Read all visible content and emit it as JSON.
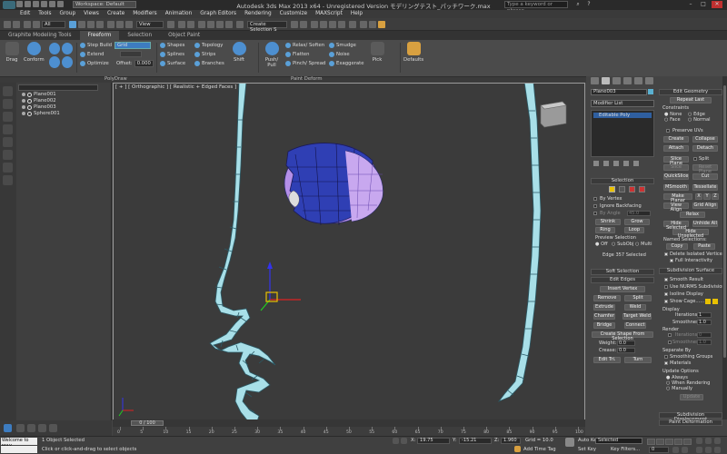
{
  "window": {
    "title": "Autodesk 3ds Max  2013 x64  -  Unregistered Version   モデリングテスト_パッチワーク.max",
    "workspace": "Workspace: Default",
    "search_placeholder": "Type a keyword or phrase"
  },
  "menubar": [
    "Edit",
    "Tools",
    "Group",
    "Views",
    "Create",
    "Modifiers",
    "Animation",
    "Graph Editors",
    "Rendering",
    "Customize",
    "MAXScript",
    "Help"
  ],
  "main_toolbar": {
    "selection_filter": "All",
    "reference_coord": "View",
    "named_selection": "Create Selection S"
  },
  "ribbon_tabs": [
    "Graphite Modeling Tools",
    "Freeform",
    "Selection",
    "Object Paint"
  ],
  "ribbon_active_tab": 1,
  "ribbon": {
    "drag": "Drag",
    "conform": "Conform",
    "step_build": "Step Build",
    "extend": "Extend",
    "optimize": "Optimize",
    "grid_value": "Grid",
    "offset_label": "Offset:",
    "offset_value": "0.000",
    "shapes": "Shapes",
    "splines": "Splines",
    "surface": "Surface",
    "topology": "Topology",
    "strips": "Strips",
    "branches": "Branches",
    "shift": "Shift",
    "push_pull": "Push/\nPull",
    "relax_soften": "Relax/ Soften",
    "flatten": "Flatten",
    "pinch_spread": "Pinch/ Spread",
    "smudge": "Smudge",
    "noise": "Noise",
    "exaggerate": "Exaggerate",
    "pick": "Pick",
    "defaults": "Defaults",
    "group_polydraw": "PolyDraw",
    "group_paint_deform": "Paint Deform"
  },
  "scene_explorer": {
    "items": [
      "Plane001",
      "Plane002",
      "Plane003",
      "Sphere001"
    ]
  },
  "viewport": {
    "label": "[ + ] [ Orthographic ] [ Realistic + Edged Faces ]",
    "colors": {
      "ribbon_fill": "#a8dfe8",
      "ribbon_stroke": "#2b5a66",
      "sphere_dark": "#2f3fb4",
      "sphere_light": "#b48fe8",
      "gizmo_x": "#d22",
      "gizmo_y": "#2c2",
      "gizmo_z": "#33e",
      "gizmo_box": "#e8c000"
    }
  },
  "command_panel": {
    "object_name": "Plane003",
    "modifier_list": "Modifier List",
    "stack_item": "Editable Poly",
    "selection_title": "Selection",
    "by_vertex": "By Vertex",
    "ignore_backfacing": "Ignore Backfacing",
    "by_angle": "By Angle",
    "by_angle_value": "45.0",
    "shrink": "Shrink",
    "grow": "Grow",
    "ring": "Ring",
    "loop": "Loop",
    "preview_selection": "Preview Selection",
    "preview_off": "Off",
    "preview_subobj": "SubObj",
    "preview_multi": "Multi",
    "selected_info": "Edge 357 Selected",
    "soft_selection": "Soft Selection",
    "edit_edges": "Edit Edges",
    "insert_vertex": "Insert Vertex",
    "remove": "Remove",
    "split": "Split",
    "extrude": "Extrude",
    "weld": "Weld",
    "chamfer": "Chamfer",
    "target_weld": "Target Weld",
    "bridge": "Bridge",
    "connect": "Connect",
    "create_shape": "Create Shape From Selection",
    "weight": "Weight:",
    "weight_value": "0.0",
    "crease": "Crease:",
    "crease_value": "0.0",
    "edit_tri": "Edit Tri.",
    "turn": "Turn",
    "edit_geometry": "Edit Geometry",
    "repeat_last": "Repeat Last",
    "constraints": "Constraints",
    "c_none": "None",
    "c_edge": "Edge",
    "c_face": "Face",
    "c_normal": "Normal",
    "preserve_uvs": "Preserve UVs",
    "create": "Create",
    "collapse": "Collapse",
    "attach": "Attach",
    "detach": "Detach",
    "slice_plane": "Slice Plane",
    "split_chk": "Split",
    "slice": "Slice",
    "reset_plane": "Reset Plane",
    "quickslice": "QuickSlice",
    "cut": "Cut",
    "msmooth": "MSmooth",
    "tessellate": "Tessellate",
    "make_planar": "Make Planar",
    "x": "X",
    "y": "Y",
    "z": "Z",
    "view_align": "View Align",
    "grid_align": "Grid Align",
    "relax": "Relax",
    "hide_selected": "Hide Selected",
    "unhide_all": "Unhide All",
    "hide_unselected": "Hide Unselected",
    "named_selections": "Named Selections:",
    "copy": "Copy",
    "paste": "Paste",
    "delete_isolated": "Delete Isolated Vertices",
    "full_interactivity": "Full Interactivity",
    "subdivision_surface": "Subdivision Surface",
    "smooth_result": "Smooth Result",
    "use_nurms": "Use NURMS Subdivision",
    "isoline_display": "Isoline Display",
    "show_cage": "Show Cage......",
    "display": "Display",
    "iterations": "Iterations:",
    "iterations_value": "1",
    "smoothness": "Smoothness:",
    "smoothness_value": "1.0",
    "render": "Render",
    "r_iterations_value": "0",
    "r_smoothness_value": "1.0",
    "separate_by": "Separate By",
    "smoothing_groups": "Smoothing Groups",
    "materials": "Materials",
    "update_options": "Update Options",
    "always": "Always",
    "when_rendering": "When Rendering",
    "manually": "Manually",
    "update": "Update",
    "subdivision_displacement": "Subdivision Displacement",
    "paint_deformation": "Paint Deformation"
  },
  "timeline": {
    "slider": "0 / 100",
    "ticks": [
      "0",
      "5",
      "10",
      "15",
      "20",
      "25",
      "30",
      "35",
      "40",
      "45",
      "50",
      "55",
      "60",
      "65",
      "70",
      "75",
      "80",
      "85",
      "90",
      "95",
      "100"
    ]
  },
  "statusbar": {
    "maxscript": "Welcome to MAX",
    "status": "1 Object Selected",
    "prompt": "Click or click-and-drag to select objects",
    "x_label": "X:",
    "x": "19.75",
    "y_label": "Y:",
    "y": "-15.21",
    "z_label": "Z:",
    "z": "1.960",
    "grid": "Grid = 10.0",
    "auto_key": "Auto Key",
    "set_key": "Set Key",
    "key_mode": "Selected",
    "key_filters": "Key Filters...",
    "add_time_tag": "Add Time Tag",
    "frame": "0"
  }
}
